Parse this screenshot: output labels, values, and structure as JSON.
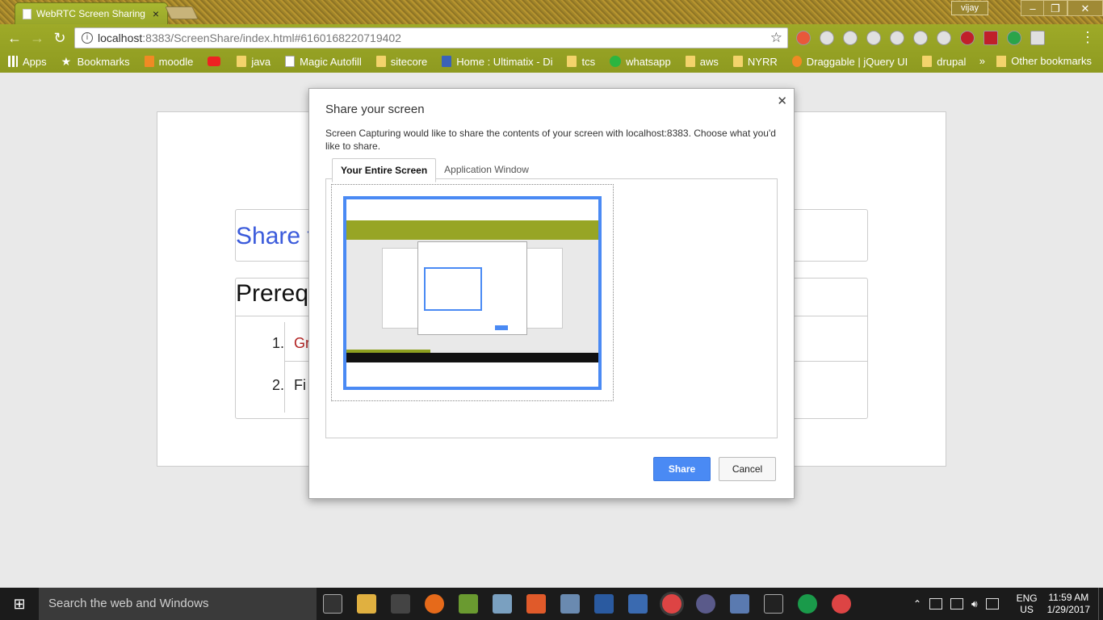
{
  "browser": {
    "tab_title": "WebRTC Screen Sharing",
    "profile": "vijay",
    "url_host": "localhost",
    "url_path": ":8383/ScreenShare/index.html#6160168220719402",
    "bookmarks": [
      "Apps",
      "Bookmarks",
      "moodle",
      "java",
      "Magic Autofill",
      "sitecore",
      "Home : Ultimatix - Di",
      "tcs",
      "whatsapp",
      "aws",
      "NYRR",
      "Draggable | jQuery UI",
      "drupal"
    ],
    "overflow": "»",
    "other_bookmarks": "Other bookmarks",
    "theme_color": "#97a525"
  },
  "page": {
    "share_heading": "Share t",
    "prereq_heading": "Prerequ",
    "list": [
      {
        "num": "1.",
        "text": "Gr"
      },
      {
        "num": "2.",
        "text": "Fi"
      }
    ]
  },
  "dialog": {
    "title": "Share your screen",
    "description": "Screen Capturing would like to share the contents of your screen with localhost:8383. Choose what you'd like to share.",
    "tabs": [
      "Your Entire Screen",
      "Application Window"
    ],
    "share_label": "Share",
    "cancel_label": "Cancel",
    "accent": "#4a8af4"
  },
  "taskbar": {
    "search_placeholder": "Search the web and Windows",
    "lang_top": "ENG",
    "lang_bottom": "US",
    "time": "11:59 AM",
    "date": "1/29/2017"
  }
}
